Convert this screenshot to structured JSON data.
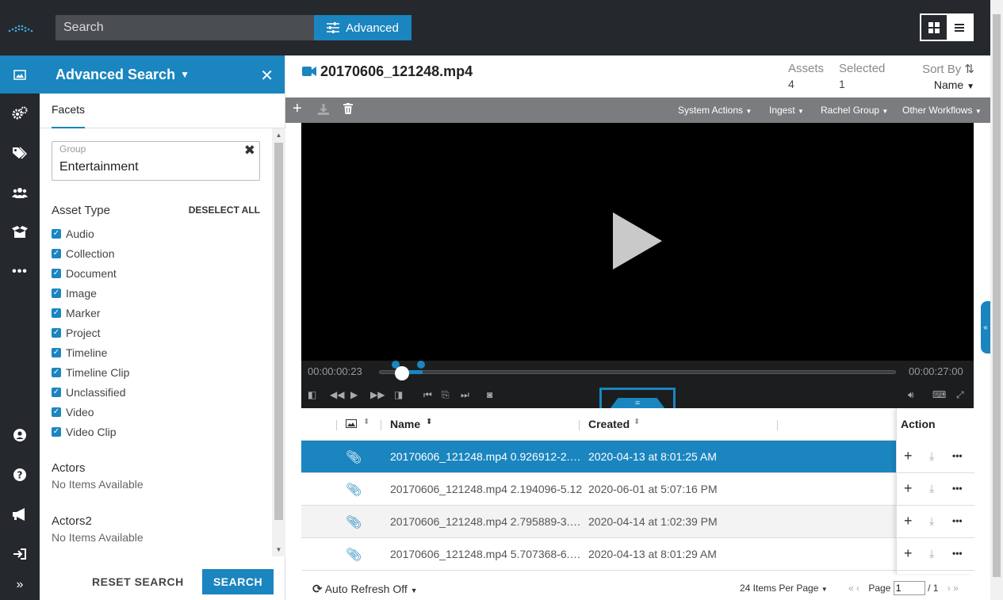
{
  "topbar": {
    "search_placeholder": "Search",
    "advanced_label": "Advanced"
  },
  "panel": {
    "title": "Advanced Search",
    "tab_facets": "Facets",
    "group_label": "Group",
    "group_value": "Entertainment",
    "asset_type_title": "Asset Type",
    "deselect_all": "DESELECT ALL",
    "asset_types": [
      "Audio",
      "Collection",
      "Document",
      "Image",
      "Marker",
      "Project",
      "Timeline",
      "Timeline Clip",
      "Unclassified",
      "Video",
      "Video Clip"
    ],
    "actors_title": "Actors",
    "actors_empty": "No Items Available",
    "actors2_title": "Actors2",
    "actors2_empty": "No Items Available",
    "reset_label": "RESET SEARCH",
    "search_label": "SEARCH"
  },
  "main": {
    "title": "20170606_121248.mp4",
    "assets_label": "Assets",
    "assets_value": "4",
    "selected_label": "Selected",
    "selected_value": "1",
    "sort_label": "Sort By",
    "sort_value": "Name",
    "menus": [
      "System Actions",
      "Ingest",
      "Rachel Group",
      "Other Workflows"
    ],
    "time_current": "00:00:00:23",
    "time_total": "00:00:27:00",
    "playhead_fraction": 0.031,
    "col_name": "Name",
    "col_created": "Created",
    "col_action": "Action",
    "rows": [
      {
        "name": "20170606_121248.mp4 0.926912-2.1…",
        "created": "2020-04-13 at 8:01:25 AM"
      },
      {
        "name": "20170606_121248.mp4 2.194096-5.12",
        "created": "2020-06-01 at 5:07:16 PM"
      },
      {
        "name": "20170606_121248.mp4 2.795889-3.3…",
        "created": "2020-04-14 at 1:02:39 PM"
      },
      {
        "name": "20170606_121248.mp4 5.707368-6.9…",
        "created": "2020-04-13 at 8:01:29 AM"
      }
    ],
    "auto_refresh": "Auto Refresh",
    "auto_refresh_state": "Off",
    "items_per_page": "24 Items Per Page",
    "page_label": "Page",
    "page_value": "1",
    "page_total": "/ 1"
  },
  "colors": {
    "accent": "#1a85bf",
    "dark": "#25282c"
  }
}
